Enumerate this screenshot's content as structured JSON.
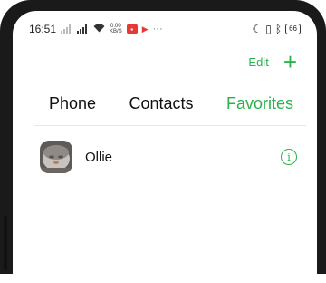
{
  "status_bar": {
    "time": "16:51",
    "speed_top": "0.00",
    "speed_bottom": "KB/S",
    "battery": "66",
    "dots": "···"
  },
  "header": {
    "edit_label": "Edit",
    "add_symbol": "+"
  },
  "tabs": [
    {
      "label": "Phone"
    },
    {
      "label": "Contacts"
    },
    {
      "label": "Favorites"
    }
  ],
  "favorites": [
    {
      "name": "Ollie"
    }
  ],
  "colors": {
    "accent": "#29b34a",
    "text": "#111111",
    "divider": "#e6e6e6"
  }
}
